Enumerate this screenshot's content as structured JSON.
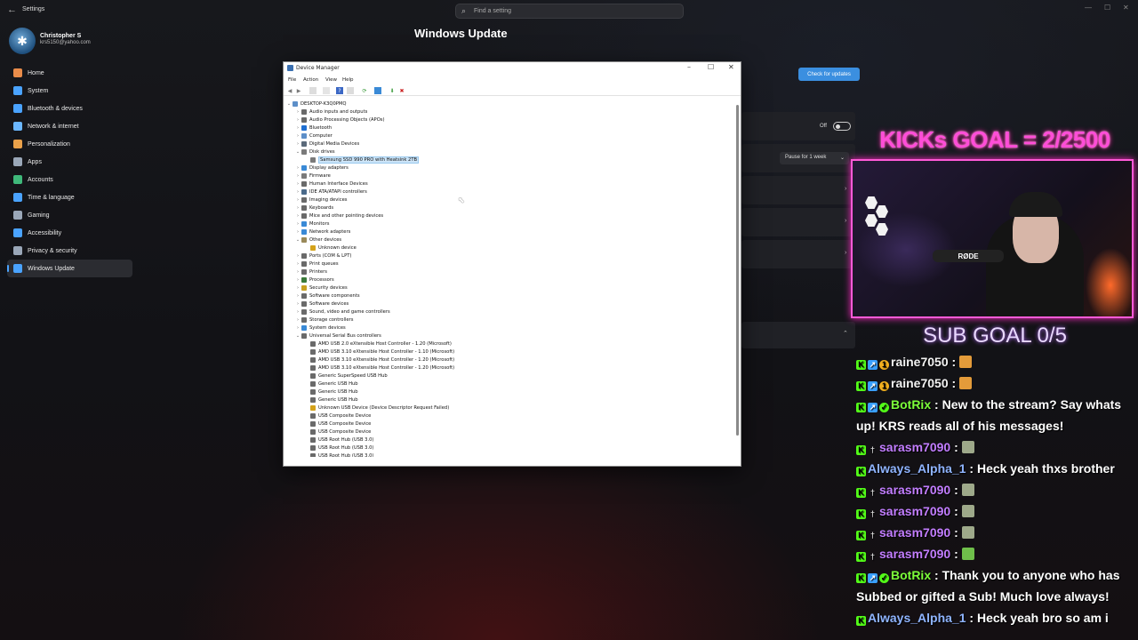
{
  "settings": {
    "app_title": "Settings",
    "search_placeholder": "Find a setting",
    "profile": {
      "name": "Christopher S",
      "email": "krs5150@yahoo.com"
    },
    "nav": [
      {
        "label": "Home",
        "icon": "home-icon",
        "color": "#e98c4a"
      },
      {
        "label": "System",
        "icon": "system-icon",
        "color": "#4aa3ff"
      },
      {
        "label": "Bluetooth & devices",
        "icon": "bluetooth-icon",
        "color": "#4aa3ff"
      },
      {
        "label": "Network & internet",
        "icon": "network-icon",
        "color": "#6bb7ff"
      },
      {
        "label": "Personalization",
        "icon": "brush-icon",
        "color": "#e9a14a"
      },
      {
        "label": "Apps",
        "icon": "apps-icon",
        "color": "#9aa7b8"
      },
      {
        "label": "Accounts",
        "icon": "accounts-icon",
        "color": "#3fb87a"
      },
      {
        "label": "Time & language",
        "icon": "time-icon",
        "color": "#4aa3ff"
      },
      {
        "label": "Gaming",
        "icon": "gaming-icon",
        "color": "#9aa7b8"
      },
      {
        "label": "Accessibility",
        "icon": "accessibility-icon",
        "color": "#4aa3ff"
      },
      {
        "label": "Privacy & security",
        "icon": "shield-icon",
        "color": "#9aa7b8"
      },
      {
        "label": "Windows Update",
        "icon": "update-icon",
        "color": "#4aa3ff"
      }
    ],
    "active_nav": "Windows Update",
    "page_title": "Windows Update",
    "check_updates_label": "Check for updates",
    "toggle_state": "Off",
    "pause_label": "Pause for 1 week"
  },
  "device_manager": {
    "title": "Device Manager",
    "menu": [
      "File",
      "Action",
      "View",
      "Help"
    ],
    "computer": "DESKTOP-K3Q0PMQ",
    "tree": [
      {
        "label": "Audio inputs and outputs",
        "level": 1,
        "exp": "›",
        "color": "#6a6a6a"
      },
      {
        "label": "Audio Processing Objects (APOs)",
        "level": 1,
        "exp": "›",
        "color": "#6a6a6a"
      },
      {
        "label": "Bluetooth",
        "level": 1,
        "exp": "›",
        "color": "#1f6fd1"
      },
      {
        "label": "Computer",
        "level": 1,
        "exp": "›",
        "color": "#5d8fc8"
      },
      {
        "label": "Digital Media Devices",
        "level": 1,
        "exp": "›",
        "color": "#5b6a7a"
      },
      {
        "label": "Disk drives",
        "level": 1,
        "exp": "⌄",
        "color": "#7a7a7a"
      },
      {
        "label": "Samsung SSD 990 PRO with Heatsink 2TB",
        "level": 2,
        "exp": "",
        "color": "#7a7a7a",
        "selected": true
      },
      {
        "label": "Display adapters",
        "level": 1,
        "exp": "›",
        "color": "#3a8ad6"
      },
      {
        "label": "Firmware",
        "level": 1,
        "exp": "›",
        "color": "#7a7a7a"
      },
      {
        "label": "Human Interface Devices",
        "level": 1,
        "exp": "›",
        "color": "#6a6a6a"
      },
      {
        "label": "IDE ATA/ATAPI controllers",
        "level": 1,
        "exp": "›",
        "color": "#4a6a8a"
      },
      {
        "label": "Imaging devices",
        "level": 1,
        "exp": "›",
        "color": "#6a6a6a"
      },
      {
        "label": "Keyboards",
        "level": 1,
        "exp": "›",
        "color": "#6a6a6a"
      },
      {
        "label": "Mice and other pointing devices",
        "level": 1,
        "exp": "›",
        "color": "#6a6a6a"
      },
      {
        "label": "Monitors",
        "level": 1,
        "exp": "›",
        "color": "#3a8ad6"
      },
      {
        "label": "Network adapters",
        "level": 1,
        "exp": "›",
        "color": "#3a8ad6"
      },
      {
        "label": "Other devices",
        "level": 1,
        "exp": "⌄",
        "color": "#9a8a5a"
      },
      {
        "label": "Unknown device",
        "level": 2,
        "exp": "",
        "color": "#d4a21a"
      },
      {
        "label": "Ports (COM & LPT)",
        "level": 1,
        "exp": "›",
        "color": "#6a6a6a"
      },
      {
        "label": "Print queues",
        "level": 1,
        "exp": "›",
        "color": "#6a6a6a"
      },
      {
        "label": "Printers",
        "level": 1,
        "exp": "›",
        "color": "#6a6a6a"
      },
      {
        "label": "Processors",
        "level": 1,
        "exp": "›",
        "color": "#3a7a3a"
      },
      {
        "label": "Security devices",
        "level": 1,
        "exp": "›",
        "color": "#c8a020"
      },
      {
        "label": "Software components",
        "level": 1,
        "exp": "›",
        "color": "#6a6a6a"
      },
      {
        "label": "Software devices",
        "level": 1,
        "exp": "›",
        "color": "#6a6a6a"
      },
      {
        "label": "Sound, video and game controllers",
        "level": 1,
        "exp": "›",
        "color": "#6a6a6a"
      },
      {
        "label": "Storage controllers",
        "level": 1,
        "exp": "›",
        "color": "#6a6a6a"
      },
      {
        "label": "System devices",
        "level": 1,
        "exp": "›",
        "color": "#3a8ad6"
      },
      {
        "label": "Universal Serial Bus controllers",
        "level": 1,
        "exp": "⌄",
        "color": "#6a6a6a"
      },
      {
        "label": "AMD USB 2.0 eXtensible Host Controller - 1.20 (Microsoft)",
        "level": 2,
        "exp": "",
        "color": "#6a6a6a"
      },
      {
        "label": "AMD USB 3.10 eXtensible Host Controller - 1.10 (Microsoft)",
        "level": 2,
        "exp": "",
        "color": "#6a6a6a"
      },
      {
        "label": "AMD USB 3.10 eXtensible Host Controller - 1.20 (Microsoft)",
        "level": 2,
        "exp": "",
        "color": "#6a6a6a"
      },
      {
        "label": "AMD USB 3.10 eXtensible Host Controller - 1.20 (Microsoft)",
        "level": 2,
        "exp": "",
        "color": "#6a6a6a"
      },
      {
        "label": "Generic SuperSpeed USB Hub",
        "level": 2,
        "exp": "",
        "color": "#6a6a6a"
      },
      {
        "label": "Generic USB Hub",
        "level": 2,
        "exp": "",
        "color": "#6a6a6a"
      },
      {
        "label": "Generic USB Hub",
        "level": 2,
        "exp": "",
        "color": "#6a6a6a"
      },
      {
        "label": "Generic USB Hub",
        "level": 2,
        "exp": "",
        "color": "#6a6a6a"
      },
      {
        "label": "Unknown USB Device (Device Descriptor Request Failed)",
        "level": 2,
        "exp": "",
        "color": "#d4a21a"
      },
      {
        "label": "USB Composite Device",
        "level": 2,
        "exp": "",
        "color": "#6a6a6a"
      },
      {
        "label": "USB Composite Device",
        "level": 2,
        "exp": "",
        "color": "#6a6a6a"
      },
      {
        "label": "USB Composite Device",
        "level": 2,
        "exp": "",
        "color": "#6a6a6a"
      },
      {
        "label": "USB Root Hub (USB 3.0)",
        "level": 2,
        "exp": "",
        "color": "#6a6a6a"
      },
      {
        "label": "USB Root Hub (USB 3.0)",
        "level": 2,
        "exp": "",
        "color": "#6a6a6a"
      },
      {
        "label": "USB Root Hub (USB 3.0)",
        "level": 2,
        "exp": "",
        "color": "#6a6a6a"
      }
    ]
  },
  "overlay": {
    "kicks_goal": "KICKs GOAL = 2/2500",
    "sub_goal": "SUB GOAL 0/5",
    "webcam_mic_brand": "RØDE",
    "chat": [
      {
        "user": "raine7050",
        "color": "#f2f2f2",
        "badges": [
          "k",
          "blue",
          "gold"
        ],
        "text": "",
        "emote": "#e39b3a"
      },
      {
        "user": "raine7050",
        "color": "#f2f2f2",
        "badges": [
          "k",
          "blue",
          "gold"
        ],
        "text": "",
        "emote": "#e39b3a"
      },
      {
        "user": "BotRix",
        "color": "#7cff3a",
        "badges": [
          "k",
          "blue",
          "check"
        ],
        "text": "New to the stream? Say whats up! KRS reads all of his messages!",
        "emote": ""
      },
      {
        "user": "sarasm7090",
        "color": "#c27dff",
        "badges": [
          "k",
          "sword"
        ],
        "text": "",
        "emote": "#9ea98a"
      },
      {
        "user": "Always_Alpha_1",
        "color": "#8fb4ff",
        "badges": [
          "k"
        ],
        "text": "Heck yeah thxs brother",
        "emote": ""
      },
      {
        "user": "sarasm7090",
        "color": "#c27dff",
        "badges": [
          "k",
          "sword"
        ],
        "text": "",
        "emote": "#9ea98a"
      },
      {
        "user": "sarasm7090",
        "color": "#c27dff",
        "badges": [
          "k",
          "sword"
        ],
        "text": "",
        "emote": "#9ea98a"
      },
      {
        "user": "sarasm7090",
        "color": "#c27dff",
        "badges": [
          "k",
          "sword"
        ],
        "text": "",
        "emote": "#9ea98a"
      },
      {
        "user": "sarasm7090",
        "color": "#c27dff",
        "badges": [
          "k",
          "sword"
        ],
        "text": "",
        "emote": "#6fbf4a"
      },
      {
        "user": "BotRix",
        "color": "#7cff3a",
        "badges": [
          "k",
          "blue",
          "check"
        ],
        "text": "Thank you to anyone who has Subbed or gifted a Sub! Much love always!",
        "emote": ""
      },
      {
        "user": "Always_Alpha_1",
        "color": "#8fb4ff",
        "badges": [
          "k"
        ],
        "text": "Heck yeah bro so am i",
        "emote": ""
      }
    ]
  }
}
